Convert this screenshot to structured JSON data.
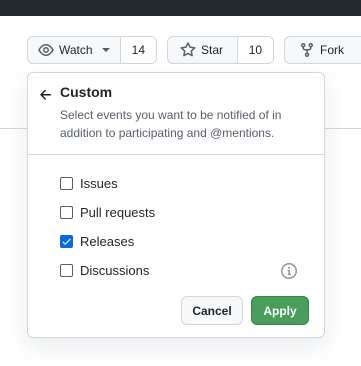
{
  "toolbar": {
    "watch": {
      "label": "Watch",
      "count": "14",
      "icon": "eye-icon"
    },
    "star": {
      "label": "Star",
      "count": "10",
      "icon": "star-icon"
    },
    "fork": {
      "label": "Fork",
      "icon": "repo-forked-icon"
    }
  },
  "dropdown": {
    "title": "Custom",
    "description": "Select events you want to be notified of in addition to participating and @mentions.",
    "options": [
      {
        "label": "Issues",
        "checked": false
      },
      {
        "label": "Pull requests",
        "checked": false
      },
      {
        "label": "Releases",
        "checked": true
      },
      {
        "label": "Discussions",
        "checked": false
      }
    ],
    "cancel_label": "Cancel",
    "apply_label": "Apply"
  },
  "colors": {
    "topbar": "#24292f",
    "apply_bg": "#4a9e5c",
    "checkbox_checked": "#0969da",
    "border": "#d0d7de"
  }
}
